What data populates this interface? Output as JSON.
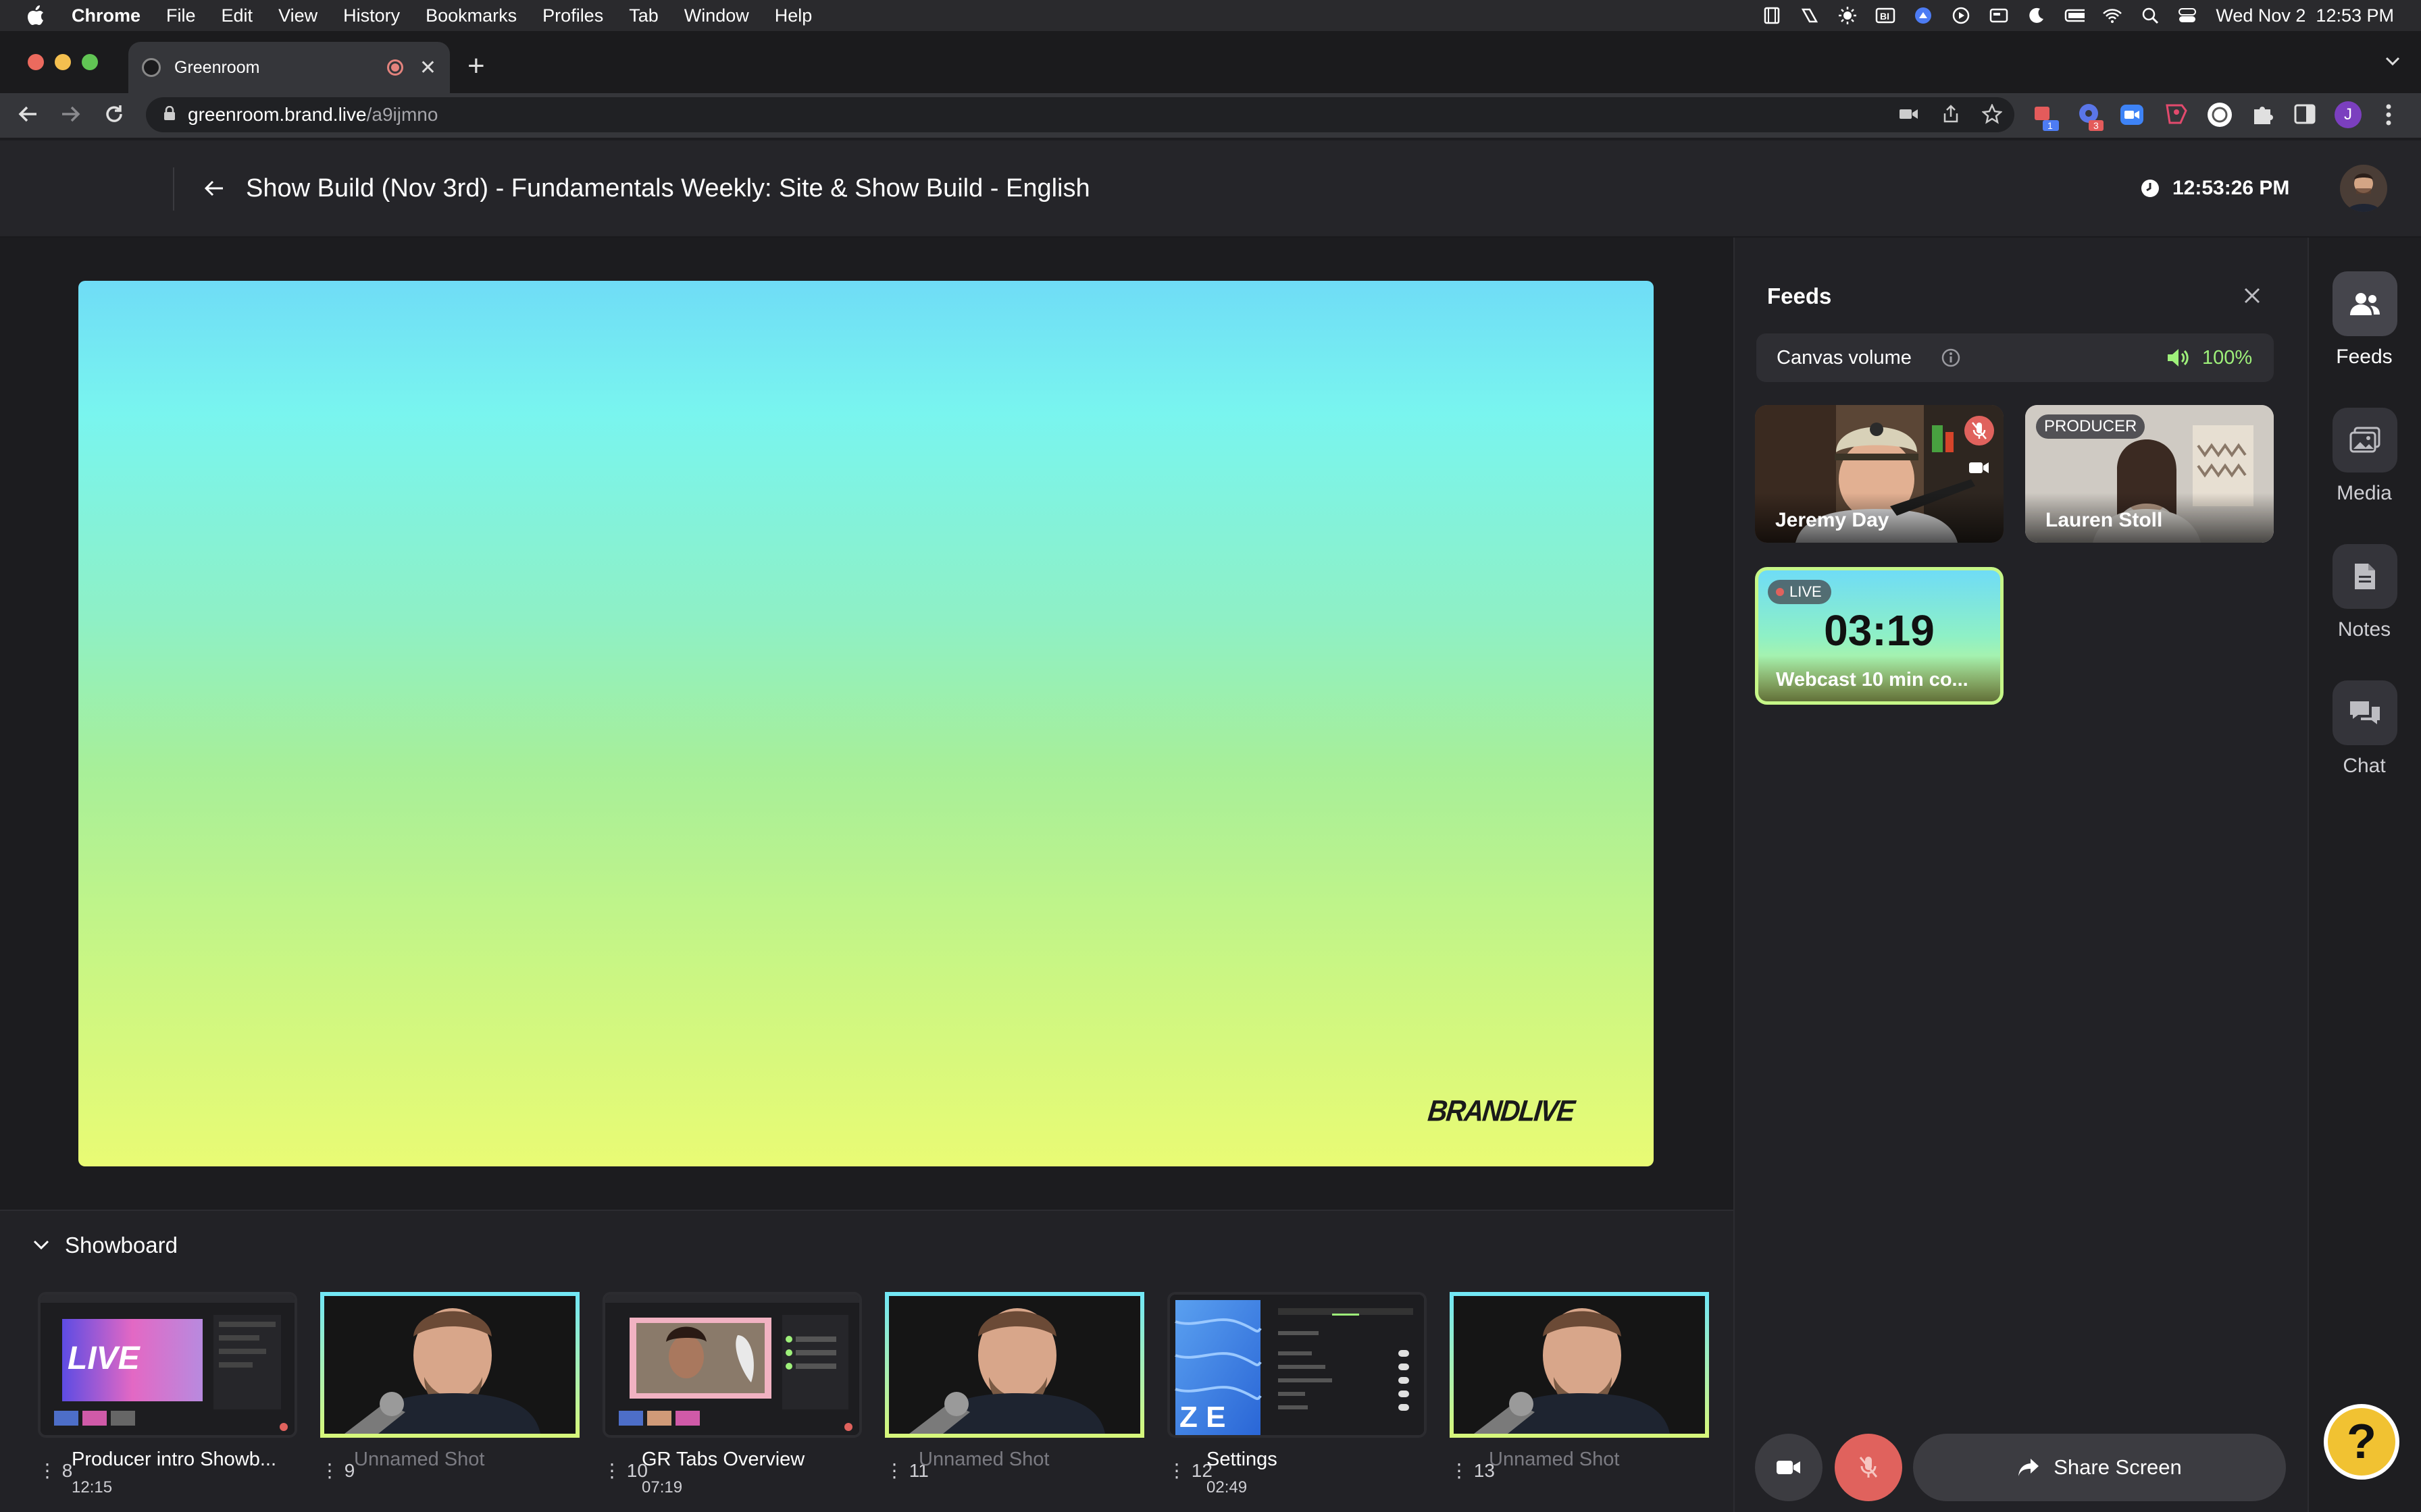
{
  "menubar": {
    "app": "Chrome",
    "items": [
      "File",
      "Edit",
      "View",
      "History",
      "Bookmarks",
      "Profiles",
      "Tab",
      "Window",
      "Help"
    ],
    "datetime": "Wed Nov 2  12:53 PM"
  },
  "browser": {
    "tab_title": "Greenroom",
    "url_host": "greenroom.brand.live",
    "url_path": "/a9ijmno",
    "profile_initial": "J",
    "ext_badge_1": "1",
    "ext_badge_2": "3"
  },
  "header": {
    "title": "Show Build (Nov 3rd) - Fundamentals Weekly: Site & Show Build - English",
    "clock": "12:53:26 PM"
  },
  "canvas": {
    "watermark": "BRANDLIVE"
  },
  "showboard": {
    "title": "Showboard",
    "shots": [
      {
        "num": "8",
        "label": "Producer intro Showb...",
        "time": "12:15"
      },
      {
        "num": "9",
        "label": "Unnamed Shot",
        "time": ""
      },
      {
        "num": "10",
        "label": "GR Tabs Overview",
        "time": "07:19"
      },
      {
        "num": "11",
        "label": "Unnamed Shot",
        "time": ""
      },
      {
        "num": "12",
        "label": "Settings",
        "time": "02:49"
      },
      {
        "num": "13",
        "label": "Unnamed Shot",
        "time": ""
      }
    ]
  },
  "feeds": {
    "title": "Feeds",
    "canvas_volume_label": "Canvas volume",
    "canvas_volume_value": "100%",
    "cards": [
      {
        "name": "Jeremy Day",
        "badge": ""
      },
      {
        "name": "Lauren Stoll",
        "badge": "PRODUCER"
      }
    ],
    "live_card": {
      "badge": "LIVE",
      "timer": "03:19",
      "label": "Webcast 10 min co..."
    }
  },
  "rail": {
    "items": [
      "Feeds",
      "Media",
      "Notes",
      "Chat"
    ]
  },
  "controls": {
    "share_label": "Share Screen",
    "help_glyph": "?"
  },
  "colors": {
    "accent_green": "#9ef07a",
    "mic_red": "#e0625d",
    "canvas_top": "#6fdcf6",
    "canvas_bottom": "#e9fb74"
  }
}
